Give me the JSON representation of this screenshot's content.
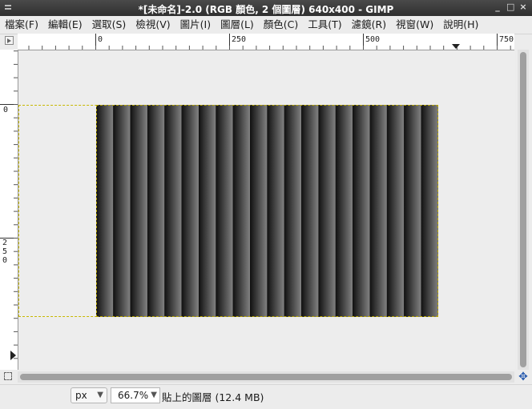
{
  "window": {
    "title": "*[未命名]-2.0 (RGB 顏色, 2 個圖層) 640x400 - GIMP",
    "controls": [
      "_",
      "□",
      "×"
    ]
  },
  "menubar": {
    "items": [
      "檔案(F)",
      "編輯(E)",
      "選取(S)",
      "檢視(V)",
      "圖片(I)",
      "圖層(L)",
      "顏色(C)",
      "工具(T)",
      "濾鏡(R)",
      "視窗(W)",
      "說明(H)"
    ]
  },
  "rulers": {
    "horizontal_labels": [
      "0",
      "250",
      "500",
      "750"
    ],
    "vertical_labels": [
      "0",
      "250"
    ]
  },
  "statusbar": {
    "unit": "px",
    "zoom": "66.7%",
    "message": "貼上的圖層 (12.4 MB)"
  },
  "colors": {
    "titlebar": "#3a3a3a",
    "selection_dash": "#c8b800",
    "gradient_dark": "#111111",
    "gradient_light": "#808080"
  },
  "icons": [
    "quick-mask-icon",
    "navigate-icon",
    "ruler-marker-icon",
    "menu-arrow-icon"
  ]
}
